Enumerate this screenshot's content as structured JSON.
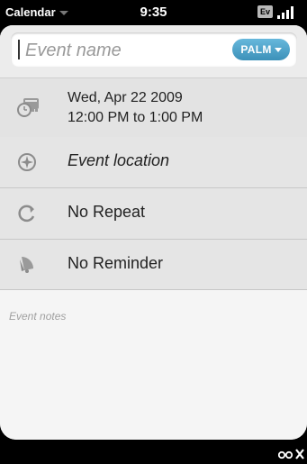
{
  "status": {
    "app_menu": "Calendar",
    "time": "9:35",
    "network_badge": "Ev"
  },
  "event": {
    "name_placeholder": "Event name",
    "calendar_label": "PALM",
    "date_line": "Wed, Apr 22 2009",
    "time_line": "12:00 PM to 1:00 PM",
    "location_placeholder": "Event location",
    "repeat_label": "No Repeat",
    "reminder_label": "No Reminder",
    "notes_placeholder": "Event notes"
  },
  "icons": {
    "datetime": "clock-calendar-icon",
    "location": "compass-icon",
    "repeat": "repeat-icon",
    "reminder": "bell-icon",
    "gesture": "gesture-icon"
  },
  "colors": {
    "accent": "#4aa3cc",
    "background": "#f1f1f1",
    "row": "#e5e5e5"
  }
}
